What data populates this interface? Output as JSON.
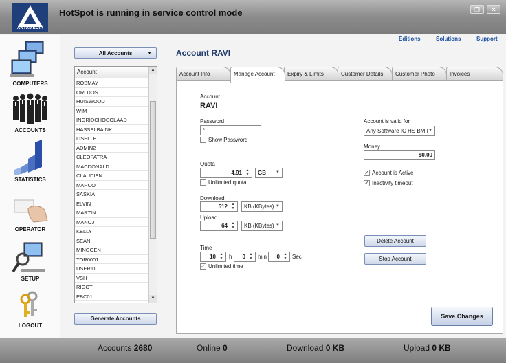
{
  "window": {
    "title": "HotSpot is running in service control mode",
    "logo_text": "ANTAMEDIA",
    "maximize_glyph": "❐",
    "close_glyph": "✕"
  },
  "nav": [
    {
      "label": "COMPUTERS",
      "icon": "computers-icon"
    },
    {
      "label": "ACCOUNTS",
      "icon": "accounts-icon"
    },
    {
      "label": "STATISTICS",
      "icon": "statistics-icon"
    },
    {
      "label": "OPERATOR",
      "icon": "operator-icon"
    },
    {
      "label": "SETUP",
      "icon": "setup-icon"
    },
    {
      "label": "LOGOUT",
      "icon": "logout-icon"
    }
  ],
  "top_links": {
    "editions": "Editions",
    "solutions": "Solutions",
    "support": "Support"
  },
  "accounts_panel": {
    "filter": "All Accounts",
    "column_header": "Account",
    "rows": [
      "ROBMAY",
      "ORLDOS",
      "HUISWOUD",
      "WIM",
      "INGRIDCHOCOLAAD",
      "HASSELBAINK",
      "LISELLE",
      "ADMIN2",
      "CLEOPATRA",
      "MACDONALD",
      "CLAUDIEN",
      "MARCO",
      "SASKIA",
      "ELVIN",
      "MARTIN",
      "MANOJ",
      "KELLY",
      "SEAN",
      "MINGOEN",
      "TOR0001",
      "USER11",
      "VSH",
      "RIGOT",
      "EBC01"
    ],
    "generate_button": "Generate Accounts"
  },
  "main": {
    "heading": "Account  RAVI",
    "tabs": [
      "Account Info",
      "Manage Account",
      "Expiry & Limits",
      "Customer Details",
      "Customer Photo",
      "Invoices"
    ],
    "active_tab": "Manage Account",
    "account_label": "Account",
    "account_name": "RAVI",
    "password_label": "Password",
    "password_value": "*",
    "show_password": "Show Password",
    "quota_label": "Quota",
    "quota_value": "4.91",
    "quota_unit": "GB",
    "unlimited_quota": "Unlimited quota",
    "download_label": "Download",
    "download_value": "512",
    "download_unit": "KB (KBytes)",
    "upload_label": "Upload",
    "upload_value": "64",
    "upload_unit": "KB (KBytes)",
    "time_label": "Time",
    "time_h": "10",
    "time_h_unit": "h",
    "time_min": "0",
    "time_min_unit": "min",
    "time_sec": "0",
    "time_sec_unit": "Sec",
    "unlimited_time": "Unlimited time",
    "valid_for_label": "Account is valid for",
    "valid_for_value": "Any Software IC HS BM I",
    "money_label": "Money",
    "money_value": "$0.00",
    "account_active": "Account is Active",
    "inactivity_timeout": "Inactivity timeout",
    "delete_button": "Delete Account",
    "stop_button": "Stop Account",
    "save_button": "Save Changes"
  },
  "checks": {
    "show_password": false,
    "unlimited_quota": false,
    "unlimited_time": true,
    "account_active": true,
    "inactivity_timeout": true
  },
  "footer": {
    "accounts_label": "Accounts",
    "accounts_value": "2680",
    "online_label": "Online",
    "online_value": "0",
    "download_label": "Download",
    "download_value": "0 KB",
    "upload_label": "Upload",
    "upload_value": "0 KB"
  }
}
